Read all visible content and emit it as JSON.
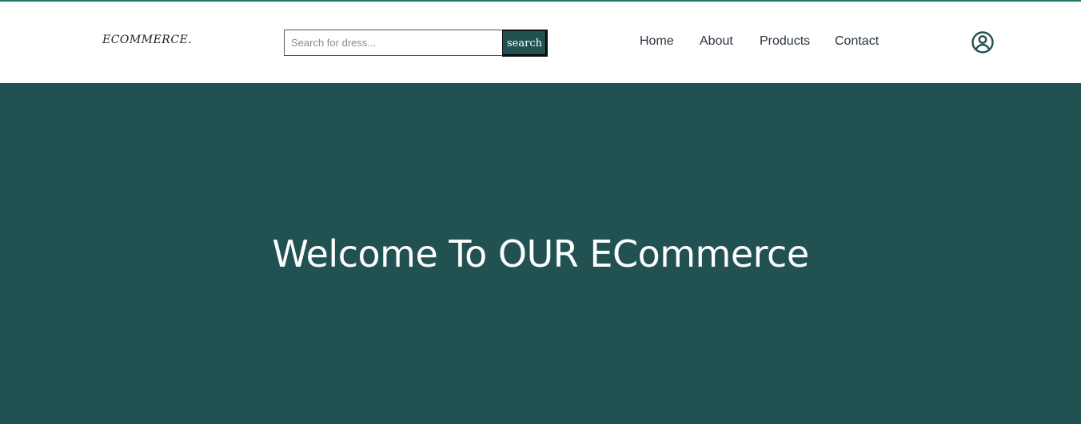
{
  "brand": {
    "logo_text": "ECOMMERCE."
  },
  "search": {
    "placeholder": "Search for dress...",
    "value": "",
    "button_label": "search"
  },
  "nav": {
    "links": [
      {
        "label": "Home"
      },
      {
        "label": "About"
      },
      {
        "label": "Products"
      },
      {
        "label": "Contact"
      }
    ],
    "user_icon": "user-circle-icon"
  },
  "hero": {
    "title": "Welcome To OUR ECommerce"
  },
  "colors": {
    "primary": "#215151",
    "accent_line": "#1e7a6a",
    "text_dark": "#2a3440"
  }
}
